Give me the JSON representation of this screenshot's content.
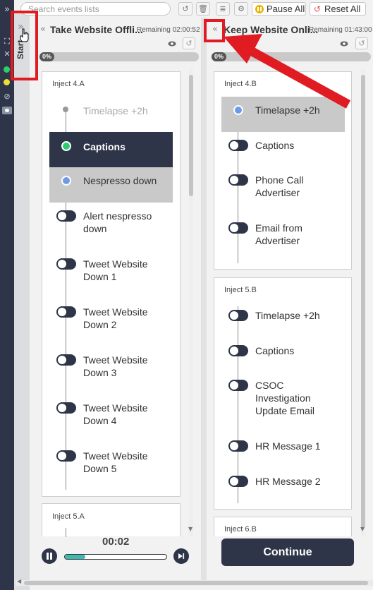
{
  "toolbar": {
    "search_placeholder": "Search events lists",
    "pause_all": "Pause All",
    "reset_all": "Reset All"
  },
  "rail": {
    "collapse_glyph": "»",
    "start_label": "Start",
    "status_colors": [
      "#2ecc71",
      "#e8e037"
    ]
  },
  "columns": [
    {
      "title": "Take Website Offli...",
      "remaining": "Remaining 02:00:52",
      "progress": "0%",
      "progress_value": 0,
      "injects": [
        {
          "title": "Inject 4.A",
          "events": [
            {
              "label": "Timelapse +2h",
              "state": "done"
            },
            {
              "label": "Captions",
              "state": "active"
            },
            {
              "label": "Nespresso down",
              "state": "current"
            },
            {
              "label": "Alert nespresso down",
              "state": "off"
            },
            {
              "label": "Tweet Website Down 1",
              "state": "off"
            },
            {
              "label": "Tweet Website Down 2",
              "state": "off"
            },
            {
              "label": "Tweet Website Down 3",
              "state": "off"
            },
            {
              "label": "Tweet Website Down 4",
              "state": "off"
            },
            {
              "label": "Tweet Website Down 5",
              "state": "off"
            }
          ]
        },
        {
          "title": "Inject 5.A",
          "events": []
        }
      ]
    },
    {
      "title": "Keep Website Onli...",
      "remaining": "Remaining 01:43:00",
      "progress": "0%",
      "progress_value": 0,
      "injects": [
        {
          "title": "Inject 4.B",
          "events": [
            {
              "label": "Timelapse +2h",
              "state": "current"
            },
            {
              "label": "Captions",
              "state": "off"
            },
            {
              "label": "Phone Call Advertiser",
              "state": "off"
            },
            {
              "label": "Email from Advertiser",
              "state": "off"
            }
          ]
        },
        {
          "title": "Inject 5.B",
          "events": [
            {
              "label": "Timelapse +2h",
              "state": "off"
            },
            {
              "label": "Captions",
              "state": "off"
            },
            {
              "label": "CSOC Investigation Update Email",
              "state": "off"
            },
            {
              "label": "HR Message 1",
              "state": "off"
            },
            {
              "label": "HR Message 2",
              "state": "off"
            }
          ]
        },
        {
          "title": "Inject 6.B",
          "events": []
        }
      ]
    }
  ],
  "player": {
    "time": "00:02",
    "progress": 0.2
  },
  "continue_label": "Continue",
  "colors": {
    "dark": "#2e3548",
    "active_green": "#2ecc71",
    "current_blue": "#6f9be6",
    "annotation_red": "#e11b22",
    "progress_teal": "#3fb8b0"
  }
}
